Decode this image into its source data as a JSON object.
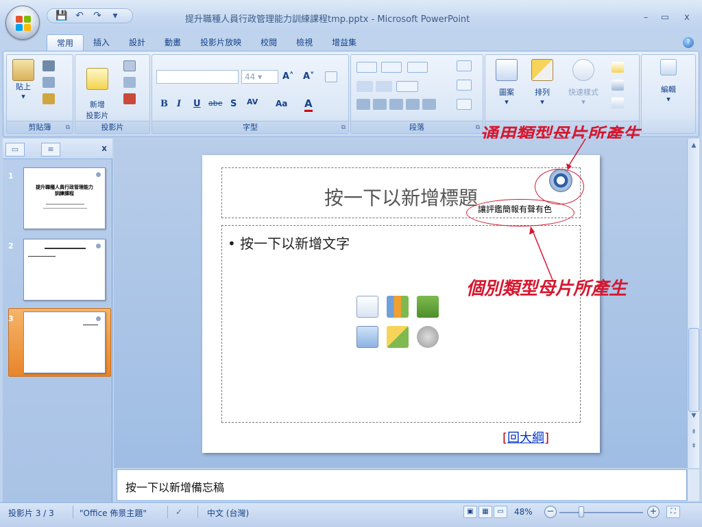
{
  "window": {
    "title": "提升職種人員行政管理能力訓練課程tmp.pptx - Microsoft PowerPoint",
    "minimize": "–",
    "restore": "▭",
    "close": "x"
  },
  "qat": {
    "save": "💾",
    "undo": "↶",
    "redo": "↷",
    "more": "▾"
  },
  "tabs": [
    "常用",
    "插入",
    "設計",
    "動畫",
    "投影片放映",
    "校閱",
    "檢視",
    "增益集"
  ],
  "help": "?",
  "ribbon": {
    "clipboard": {
      "label": "剪貼簿",
      "paste": "貼上"
    },
    "slides": {
      "label": "投影片",
      "new_slide": "新增\n投影片"
    },
    "font": {
      "label": "字型",
      "size": "44",
      "bold": "B",
      "italic": "I",
      "underline": "U",
      "strike": "abe",
      "shadow": "S",
      "spacing": "AV",
      "case": "Aa",
      "color": "A"
    },
    "paragraph": {
      "label": "段落"
    },
    "drawing": {
      "shapes": "圖案",
      "arrange": "排列",
      "quick_styles": "快速樣式"
    },
    "editing": {
      "label": "編輯"
    }
  },
  "outline_pane": {
    "close": "x",
    "slides": [
      {
        "num": "1",
        "title": "提升職種人員行政管理能力\n訓練課程"
      },
      {
        "num": "2",
        "title": ""
      },
      {
        "num": "3",
        "title": ""
      }
    ]
  },
  "slide": {
    "title_placeholder": "按一下以新增標題",
    "body_placeholder": "• 按一下以新增文字",
    "slogan": "讓評鑑簡報有聲有色",
    "back_link_prefix": "[",
    "back_link": "回大綱",
    "back_link_suffix": "]"
  },
  "annotations": {
    "general": "通用類型母片所產生",
    "individual": "個別類型母片所產生"
  },
  "notes_placeholder": "按一下以新增備忘稿",
  "status": {
    "slide_pos": "投影片 3 / 3",
    "theme": "\"Office 佈景主題\"",
    "language": "中文 (台灣)",
    "zoom": "48%"
  },
  "colors": {
    "accent_red": "#d6172f",
    "selection_orange": "#e8852a",
    "ribbon_blue": "#c5d8f1"
  }
}
